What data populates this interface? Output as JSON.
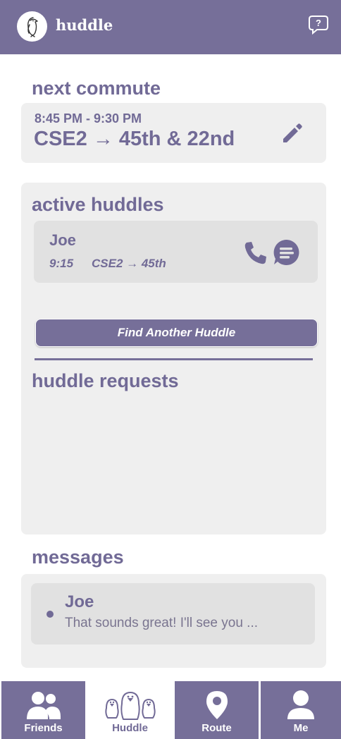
{
  "header": {
    "app_title": "huddle"
  },
  "next_commute": {
    "title": "next commute",
    "time": "8:45 PM - 9:30 PM",
    "route": "CSE2 → 45th & 22nd"
  },
  "active_huddles": {
    "title": "active huddles",
    "items": [
      {
        "name": "Joe",
        "time": "9:15",
        "route": "CSE2 → 45th"
      }
    ],
    "find_button_label": "Find Another Huddle"
  },
  "huddle_requests": {
    "title": "huddle requests"
  },
  "messages": {
    "title": "messages",
    "items": [
      {
        "name": "Joe",
        "preview": "That sounds great! I'll see you ..."
      }
    ]
  },
  "tabs": [
    {
      "label": "Friends",
      "icon": "friends-icon",
      "active": false
    },
    {
      "label": "Huddle",
      "icon": "penguins-icon",
      "active": true
    },
    {
      "label": "Route",
      "icon": "map-pin-icon",
      "active": false
    },
    {
      "label": "Me",
      "icon": "person-icon",
      "active": false
    }
  ],
  "colors": {
    "primary": "#766f99",
    "text_primary": "#716a96",
    "card_bg": "#efefef",
    "inner_card_bg": "#e1e1e1"
  }
}
